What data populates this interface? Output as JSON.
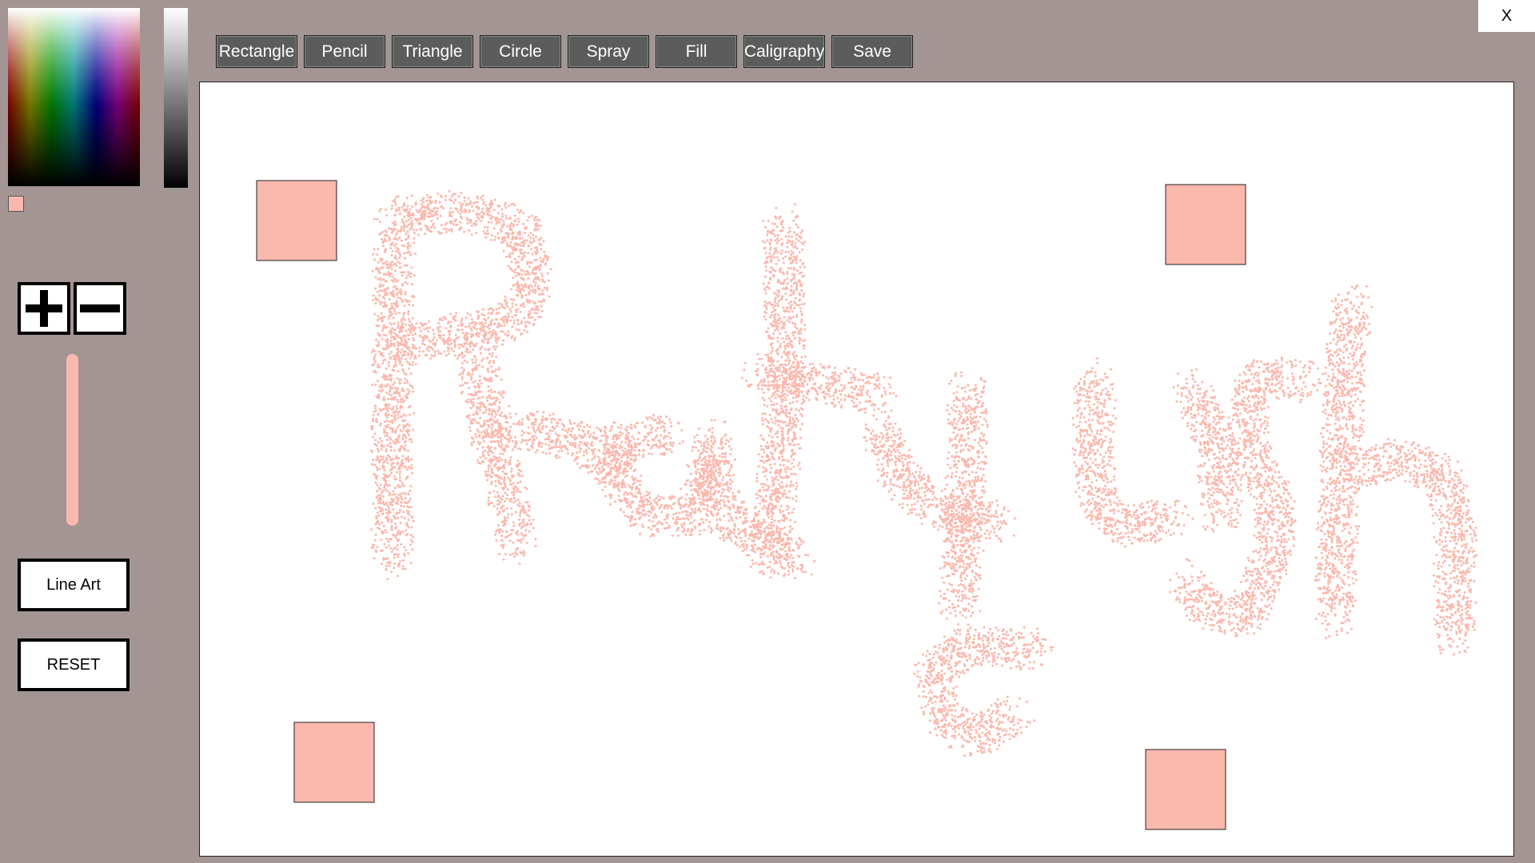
{
  "colors": {
    "background": "#a39594",
    "paint": "#fbb8ad",
    "button_bg": "#5c5c5c",
    "canvas_bg": "#ffffff"
  },
  "color_panel": {
    "picker": "hue-saturation-gradient",
    "brightness": "white-to-black-gradient",
    "selected_color": "#fbb8ad"
  },
  "size_controls": {
    "increase_icon": "plus-icon",
    "decrease_icon": "minus-icon"
  },
  "side_buttons": {
    "line_art": "Line Art",
    "reset": "RESET"
  },
  "toolbar": {
    "tools": [
      "Rectangle",
      "Pencil",
      "Triangle",
      "Circle",
      "Spray",
      "Fill",
      "Caligraphy",
      "Save"
    ]
  },
  "window": {
    "close_label": "X"
  },
  "canvas": {
    "drawn_text": "Pratyush",
    "drawing_tool": "Spray",
    "squares": 4
  }
}
